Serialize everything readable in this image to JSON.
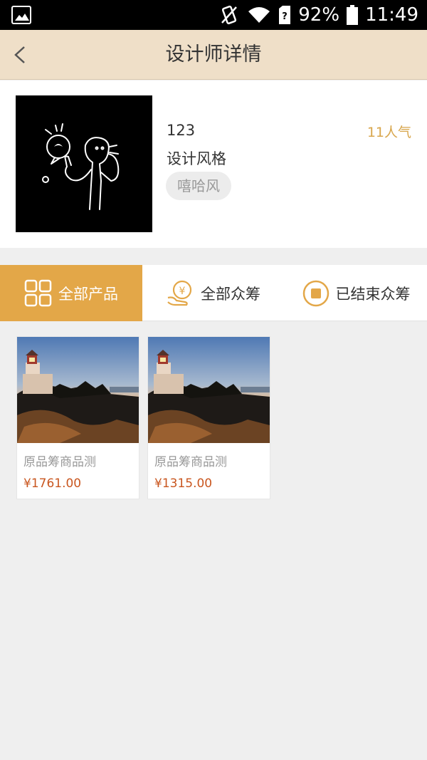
{
  "status_bar": {
    "battery": "92%",
    "time": "11:49"
  },
  "header": {
    "title": "设计师详情"
  },
  "designer": {
    "name": "123",
    "popularity": "11人气",
    "style_label": "设计风格",
    "style_tag": "嘻哈风"
  },
  "tabs": [
    {
      "label": "全部产品",
      "icon": "grid-icon",
      "active": true
    },
    {
      "label": "全部众筹",
      "icon": "yen-hand-icon",
      "active": false
    },
    {
      "label": "已结束众筹",
      "icon": "stop-circle-icon",
      "active": false
    }
  ],
  "products": [
    {
      "name": "原品筹商品测",
      "price": "¥1761.00"
    },
    {
      "name": "原品筹商品测",
      "price": "¥1315.00"
    }
  ],
  "colors": {
    "accent": "#e3a748",
    "header_bg": "#efdfc8",
    "price": "#c9561f",
    "popularity": "#d8a64c"
  }
}
